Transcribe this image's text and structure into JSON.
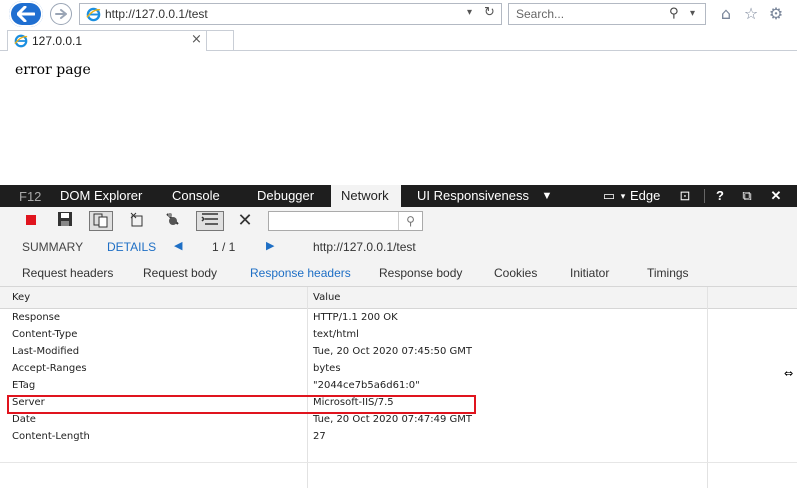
{
  "browser": {
    "url": "http://127.0.0.1/test",
    "search_placeholder": "Search...",
    "tab_title": "127.0.0.1"
  },
  "page": {
    "text": "error page"
  },
  "devtools": {
    "f12_label": "F12",
    "tabs": [
      {
        "label": "DOM Explorer",
        "active": false
      },
      {
        "label": "Console",
        "active": false
      },
      {
        "label": "Debugger",
        "active": false
      },
      {
        "label": "Network",
        "active": true
      },
      {
        "label": "UI Responsiveness",
        "active": false
      }
    ],
    "emulation_label": "Edge",
    "summary": {
      "summary_label": "SUMMARY",
      "details_label": "DETAILS",
      "pager": "1 / 1",
      "request_url": "http://127.0.0.1/test"
    },
    "subtabs": [
      {
        "label": "Request headers",
        "active": false
      },
      {
        "label": "Request body",
        "active": false
      },
      {
        "label": "Response headers",
        "active": true
      },
      {
        "label": "Response body",
        "active": false
      },
      {
        "label": "Cookies",
        "active": false
      },
      {
        "label": "Initiator",
        "active": false
      },
      {
        "label": "Timings",
        "active": false
      }
    ],
    "table": {
      "key_header": "Key",
      "value_header": "Value",
      "rows": [
        {
          "key": "Response",
          "value": "HTTP/1.1 200 OK"
        },
        {
          "key": "Content-Type",
          "value": "text/html"
        },
        {
          "key": "Last-Modified",
          "value": "Tue, 20 Oct 2020 07:45:50 GMT"
        },
        {
          "key": "Accept-Ranges",
          "value": "bytes"
        },
        {
          "key": "ETag",
          "value": "\"2044ce7b5a6d61:0\""
        },
        {
          "key": "Server",
          "value": "Microsoft-IIS/7.5"
        },
        {
          "key": "Date",
          "value": "Tue, 20 Oct 2020 07:47:49 GMT"
        },
        {
          "key": "Content-Length",
          "value": "27"
        }
      ]
    }
  },
  "colors": {
    "accent": "#1f6fd1",
    "highlight": "#e0141e",
    "devtools_bar": "#1e1e1e"
  }
}
